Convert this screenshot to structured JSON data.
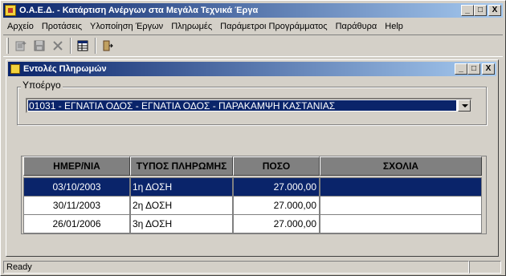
{
  "window": {
    "title": "Ο.Α.Ε.Δ. - Κατάρτιση Ανέργων στα Μεγάλα Τεχνικά Έργα",
    "buttons": [
      "_",
      "□",
      "X"
    ]
  },
  "menu": [
    {
      "label": "Αρχείο"
    },
    {
      "label": "Προτάσεις"
    },
    {
      "label": "Υλοποίηση Έργων"
    },
    {
      "label": "Πληρωμές"
    },
    {
      "label": "Παράμετροι Προγράμματος"
    },
    {
      "label": "Παράθυρα"
    },
    {
      "label": "Help"
    }
  ],
  "toolbar": {
    "icons": [
      "new-record-icon",
      "save-icon",
      "delete-icon",
      "grid-icon",
      "exit-icon"
    ]
  },
  "child": {
    "title": "Εντολές Πληρωμών",
    "buttons": [
      "_",
      "□",
      "X"
    ],
    "group_label": "Υποέργο",
    "subproject_value": "01031 - ΕΓΝΑΤΙΑ ΟΔΟΣ - ΕΓΝΑΤΙΑ ΟΔΟΣ - ΠΑΡΑΚΑΜΨΗ ΚΑΣΤΑΝΙΑΣ"
  },
  "table": {
    "headers": [
      "ΗΜΕΡ/ΝΙΑ",
      "ΤΥΠΟΣ ΠΛΗΡΩΜΗΣ",
      "ΠΟΣΟ",
      "ΣΧΟΛΙΑ"
    ],
    "rows": [
      {
        "date": "03/10/2003",
        "type": "1η ΔΟΣΗ",
        "amount": "27.000,00",
        "note": ""
      },
      {
        "date": "30/11/2003",
        "type": "2η ΔΟΣΗ",
        "amount": "27.000,00",
        "note": ""
      },
      {
        "date": "26/01/2006",
        "type": "3η ΔΟΣΗ",
        "amount": "27.000,00",
        "note": ""
      }
    ]
  },
  "status": {
    "text": "Ready"
  },
  "colors": {
    "title_active": "#0a246a",
    "face": "#d4d0c8",
    "selection": "#0a246a"
  }
}
